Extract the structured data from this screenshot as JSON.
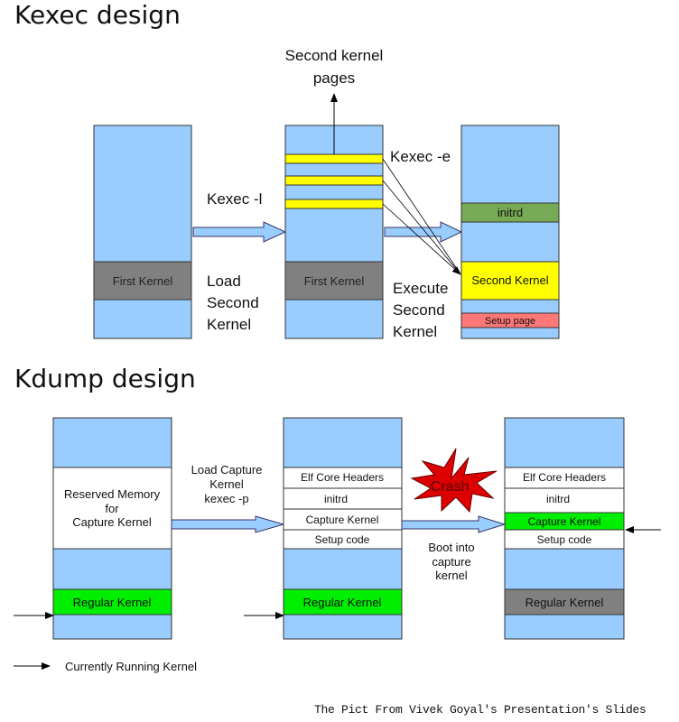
{
  "kexec": {
    "title": "Kexec design",
    "labels": {
      "second_kernel_pages_1": "Second kernel",
      "second_kernel_pages_2": "pages",
      "kexec_l": "Kexec -l",
      "load_1": "Load",
      "load_2": "Second",
      "load_3": "Kernel",
      "kexec_e": "Kexec -e",
      "exec_1": "Execute",
      "exec_2": "Second",
      "exec_3": "Kernel"
    },
    "col1": {
      "first_kernel": "First Kernel"
    },
    "col2": {
      "first_kernel": "First Kernel"
    },
    "col3": {
      "initrd": "initrd",
      "second_kernel": "Second Kernel",
      "setup_page": "Setup page"
    }
  },
  "kdump": {
    "title": "Kdump design",
    "col1": {
      "reserved_1": "Reserved Memory",
      "reserved_2": "for",
      "reserved_3": "Capture Kernel",
      "regular_kernel": "Regular Kernel"
    },
    "load_label_1": "Load Capture",
    "load_label_2": "Kernel",
    "load_label_3": "kexec -p",
    "col2": {
      "elf": "Elf Core Headers",
      "initrd": "initrd",
      "capture": "Capture Kernel",
      "setup": "Setup code",
      "regular_kernel": "Regular Kernel"
    },
    "crash": "Crash",
    "boot_1": "Boot into",
    "boot_2": "capture",
    "boot_3": "kernel",
    "col3": {
      "elf": "Elf Core Headers",
      "initrd": "initrd",
      "capture": "Capture Kernel",
      "setup": "Setup code",
      "regular_kernel": "Regular Kernel"
    }
  },
  "legend": {
    "running": "Currently Running Kernel"
  },
  "footer": "The Pict From Vivek Goyal's Presentation's Slides",
  "colors": {
    "memory": "#99ccff",
    "first_kernel": "#808080",
    "page": "#ffff00",
    "initrd_green": "#77aa55",
    "setup_red": "#ff7777",
    "kernel_green": "#00ee00",
    "crash": "#dd0000"
  }
}
